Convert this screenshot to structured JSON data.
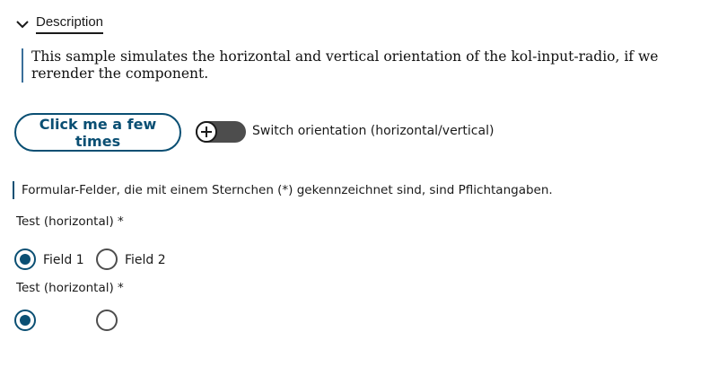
{
  "description": {
    "toggle_label": "Description",
    "text": "This sample simulates the horizontal and vertical orientation of the kol-input-radio, if we rerender the component."
  },
  "controls": {
    "click_button_label": "Click me a few times",
    "switch_label": "Switch orientation (horizontal/vertical)",
    "switch_checked": false
  },
  "form": {
    "hint": "Formular-Felder, die mit einem Sternchen (*) gekennzeichnet sind, sind Pflichtangaben.",
    "groups": [
      {
        "legend": "Test (horizontal)",
        "required_mark": "*",
        "options": [
          {
            "label": "Field 1",
            "checked": true
          },
          {
            "label": "Field 2",
            "checked": false
          }
        ]
      },
      {
        "legend": "Test (horizontal)",
        "required_mark": "*",
        "options": [
          {
            "label": "",
            "checked": true
          },
          {
            "label": "",
            "checked": false
          }
        ]
      }
    ]
  },
  "colors": {
    "accent": "#0a4f73",
    "switch_track": "#4d4d4d"
  }
}
